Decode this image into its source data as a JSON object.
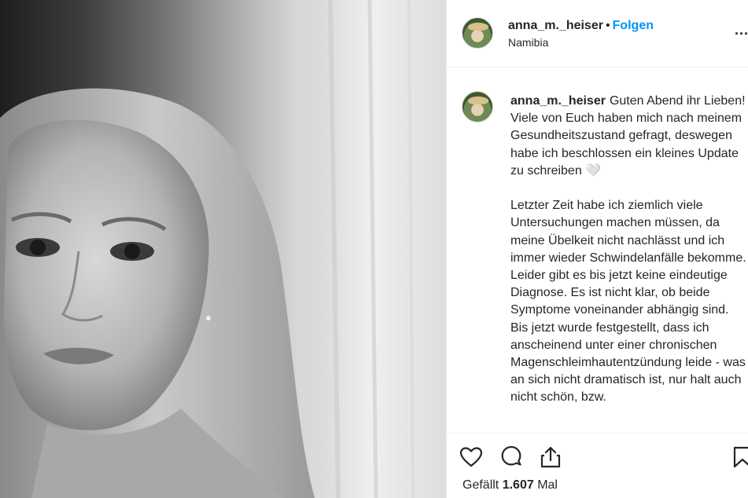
{
  "post": {
    "username": "anna_m._heiser",
    "separator": "•",
    "follow_label": "Folgen",
    "location": "Namibia",
    "more_label": "...",
    "caption": {
      "username": "anna_m._heiser",
      "text": "Guten Abend ihr Lieben!\nViele von Euch haben mich nach meinem Gesundheitszustand gefragt, deswegen habe ich beschlossen ein kleines Update zu schreiben 🤍\n\nLetzter Zeit habe ich ziemlich viele Untersuchungen machen müssen, da meine Übelkeit nicht nachlässt und ich immer wieder Schwindelanfälle bekomme. Leider gibt es bis jetzt keine eindeutige Diagnose. Es ist nicht klar, ob beide Symptome voneinander abhängig sind. Bis jetzt wurde festgestellt, dass ich anscheinend unter einer chronischen Magenschleimhautentzündung leide - was an sich nicht dramatisch ist, nur halt auch nicht schön, bzw."
    },
    "likes": {
      "prefix": "Gefällt",
      "count": "1.607",
      "suffix": "Mal"
    },
    "icons": [
      "heart-icon",
      "comment-icon",
      "share-icon",
      "bookmark-icon"
    ],
    "colors": {
      "follow": "#0095f6",
      "text": "#262626",
      "divider": "#efefef"
    }
  }
}
